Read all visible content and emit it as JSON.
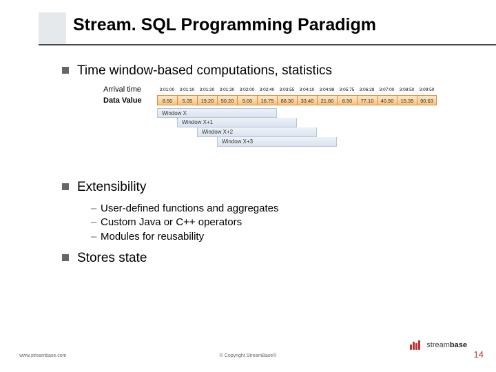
{
  "title": "Stream. SQL Programming Paradigm",
  "body": {
    "bullet1": "Time window-based computations, statistics",
    "ts": {
      "arrival_label": "Arrival time",
      "data_label": "Data Value",
      "arrival": [
        "3:01:00",
        "3:01:10",
        "3:01:20",
        "3:01:30",
        "3:02:00",
        "3:02:40",
        "3:03:55",
        "3:04:10",
        "3:04:98",
        "3:05:75",
        "3:06:28",
        "3:07:00",
        "3:08:50",
        "3:09:50"
      ],
      "values": [
        "8.50",
        "5.35",
        "19.20",
        "50.20",
        "9.00",
        "16.75",
        "88.30",
        "33.40",
        "21.80",
        "8.50",
        "77.10",
        "40.90",
        "15.35",
        "90.63"
      ],
      "windows": [
        "Window X",
        "Window X+1",
        "Window X+2",
        "Window X+3"
      ]
    },
    "bullet2": "Extensibility",
    "subs": [
      "User-defined functions and aggregates",
      "Custom Java or C++ operators",
      "Modules for reusability"
    ],
    "bullet3": "Stores state"
  },
  "footer": {
    "left": "www.streambase.com",
    "center": "© Copyright StreamBase®",
    "logo_text_prefix": "stream",
    "logo_text_bold": "base",
    "page": "14"
  }
}
